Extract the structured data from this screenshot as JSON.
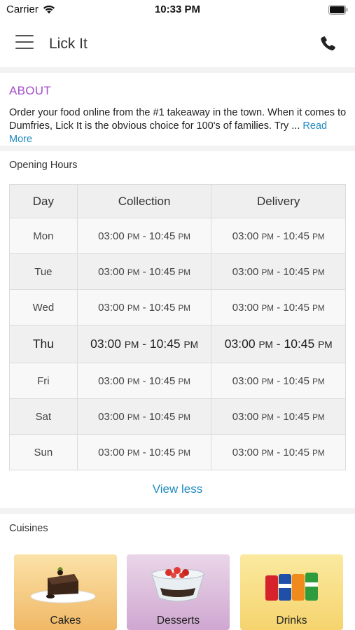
{
  "status": {
    "carrier": "Carrier",
    "time": "10:33 PM"
  },
  "header": {
    "title": "Lick It"
  },
  "about": {
    "heading": "ABOUT",
    "text": "Order your food online from the #1 takeaway in the town. When it comes to Dumfries, Lick It is the obvious choice for 100's of families. Try ...",
    "read_more": "Read More"
  },
  "hours": {
    "heading": "Opening Hours",
    "columns": [
      "Day",
      "Collection",
      "Delivery"
    ],
    "rows": [
      {
        "day": "Mon",
        "collection_open": "03:00",
        "collection_open_ampm": "PM",
        "collection_close": "10:45",
        "collection_close_ampm": "PM",
        "delivery_open": "03:00",
        "delivery_open_ampm": "PM",
        "delivery_close": "10:45",
        "delivery_close_ampm": "PM"
      },
      {
        "day": "Tue",
        "collection_open": "03:00",
        "collection_open_ampm": "PM",
        "collection_close": "10:45",
        "collection_close_ampm": "PM",
        "delivery_open": "03:00",
        "delivery_open_ampm": "PM",
        "delivery_close": "10:45",
        "delivery_close_ampm": "PM"
      },
      {
        "day": "Wed",
        "collection_open": "03:00",
        "collection_open_ampm": "PM",
        "collection_close": "10:45",
        "collection_close_ampm": "PM",
        "delivery_open": "03:00",
        "delivery_open_ampm": "PM",
        "delivery_close": "10:45",
        "delivery_close_ampm": "PM"
      },
      {
        "day": "Thu",
        "collection_open": "03:00",
        "collection_open_ampm": "PM",
        "collection_close": "10:45",
        "collection_close_ampm": "PM",
        "delivery_open": "03:00",
        "delivery_open_ampm": "PM",
        "delivery_close": "10:45",
        "delivery_close_ampm": "PM"
      },
      {
        "day": "Fri",
        "collection_open": "03:00",
        "collection_open_ampm": "PM",
        "collection_close": "10:45",
        "collection_close_ampm": "PM",
        "delivery_open": "03:00",
        "delivery_open_ampm": "PM",
        "delivery_close": "10:45",
        "delivery_close_ampm": "PM"
      },
      {
        "day": "Sat",
        "collection_open": "03:00",
        "collection_open_ampm": "PM",
        "collection_close": "10:45",
        "collection_close_ampm": "PM",
        "delivery_open": "03:00",
        "delivery_open_ampm": "PM",
        "delivery_close": "10:45",
        "delivery_close_ampm": "PM"
      },
      {
        "day": "Sun",
        "collection_open": "03:00",
        "collection_open_ampm": "PM",
        "collection_close": "10:45",
        "collection_close_ampm": "PM",
        "delivery_open": "03:00",
        "delivery_open_ampm": "PM",
        "delivery_close": "10:45",
        "delivery_close_ampm": "PM"
      }
    ],
    "view_less": "View less"
  },
  "cuisines": {
    "heading": "Cuisines",
    "items": [
      {
        "label": "Cakes",
        "icon": "cake-icon"
      },
      {
        "label": "Desserts",
        "icon": "dessert-bowl-icon"
      },
      {
        "label": "Drinks",
        "icon": "soda-cans-icon"
      }
    ]
  },
  "colors": {
    "accent_purple": "#a34fc9",
    "link_blue": "#1f8ac0"
  }
}
